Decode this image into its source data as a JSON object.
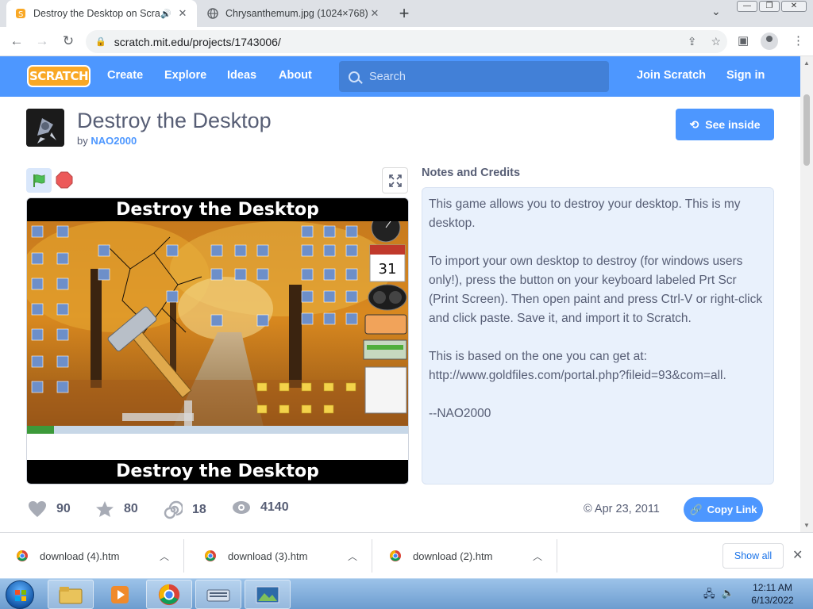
{
  "browser": {
    "tabs": [
      {
        "title": "Destroy the Desktop on Scratch",
        "active": true,
        "audio": true
      },
      {
        "title": "Chrysanthemum.jpg (1024×768)",
        "active": false
      }
    ],
    "new_tab": "+",
    "address": "scratch.mit.edu/projects/1743006/"
  },
  "scratch_nav": {
    "logo": "SCRATCH",
    "links": [
      "Create",
      "Explore",
      "Ideas",
      "About"
    ],
    "search_placeholder": "Search",
    "join": "Join Scratch",
    "signin": "Sign in"
  },
  "project": {
    "title": "Destroy the Desktop",
    "by_prefix": "by",
    "author": "NAO2000",
    "see_inside": "See inside",
    "stage_title_top": "Destroy the Desktop",
    "stage_title_bottom": "Destroy the Desktop",
    "calendar_day": "31",
    "notes_heading": "Notes and Credits",
    "notes": [
      "This game allows you to destroy your desktop. This is my desktop.",
      "To import your own desktop to destroy (for windows users only!), press the button on your keyboard labeled Prt Scr (Print Screen). Then open paint and press Ctrl-V or right-click and click paste. Save it, and import it to Scratch.",
      "This is based on the one you can get at: http://www.goldfiles.com/portal.php?fileid=93&com=all.",
      "--NAO2000"
    ],
    "stats": {
      "loves": "90",
      "favorites": "80",
      "remixes": "18",
      "views": "4140"
    },
    "shared_date": "© Apr 23, 2011",
    "copy_link": "Copy Link"
  },
  "downloads": {
    "items": [
      "download (4).htm",
      "download (3).htm",
      "download (2).htm"
    ],
    "show_all": "Show all"
  },
  "taskbar": {
    "time": "12:11 AM",
    "date": "6/13/2022"
  },
  "colors": {
    "scratch_blue": "#4d97ff",
    "scratch_text": "#575e75",
    "notes_bg": "#e9f1fc"
  }
}
